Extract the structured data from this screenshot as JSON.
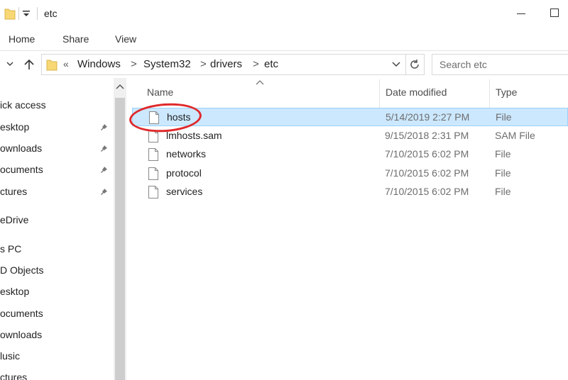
{
  "window": {
    "title": "etc"
  },
  "ribbon": {
    "tabs": [
      "Home",
      "Share",
      "View"
    ]
  },
  "address": {
    "chevron": "«",
    "crumbs": [
      "Windows",
      "System32",
      "drivers",
      "etc"
    ],
    "separator": ">"
  },
  "search": {
    "placeholder": "Search etc"
  },
  "nav": {
    "items": [
      {
        "label": "ick access",
        "pinned": false
      },
      {
        "label": "esktop",
        "pinned": true
      },
      {
        "label": "ownloads",
        "pinned": true
      },
      {
        "label": "ocuments",
        "pinned": true
      },
      {
        "label": "ctures",
        "pinned": true
      },
      {
        "label": "eDrive",
        "pinned": false
      },
      {
        "label": "s PC",
        "pinned": false
      },
      {
        "label": "D Objects",
        "pinned": false
      },
      {
        "label": "esktop",
        "pinned": false
      },
      {
        "label": "ocuments",
        "pinned": false
      },
      {
        "label": "ownloads",
        "pinned": false
      },
      {
        "label": "lusic",
        "pinned": false
      },
      {
        "label": "ctures",
        "pinned": false
      }
    ]
  },
  "columns": {
    "name": "Name",
    "date": "Date modified",
    "type": "Type"
  },
  "files": [
    {
      "name": "hosts",
      "date": "5/14/2019 2:27 PM",
      "type": "File",
      "selected": true
    },
    {
      "name": "lmhosts.sam",
      "date": "9/15/2018 2:31 PM",
      "type": "SAM File",
      "selected": false
    },
    {
      "name": "networks",
      "date": "7/10/2015 6:02 PM",
      "type": "File",
      "selected": false
    },
    {
      "name": "protocol",
      "date": "7/10/2015 6:02 PM",
      "type": "File",
      "selected": false
    },
    {
      "name": "services",
      "date": "7/10/2015 6:02 PM",
      "type": "File",
      "selected": false
    }
  ],
  "colors": {
    "selected_bg": "#cce8ff",
    "selected_border": "#99d1ff",
    "folder": "#f8d775",
    "annotation": "#e0282a"
  },
  "icons": {
    "folder": "folder-icon",
    "file": "file-icon",
    "pin": "pin-icon",
    "up": "up-arrow-icon",
    "refresh": "refresh-icon"
  }
}
